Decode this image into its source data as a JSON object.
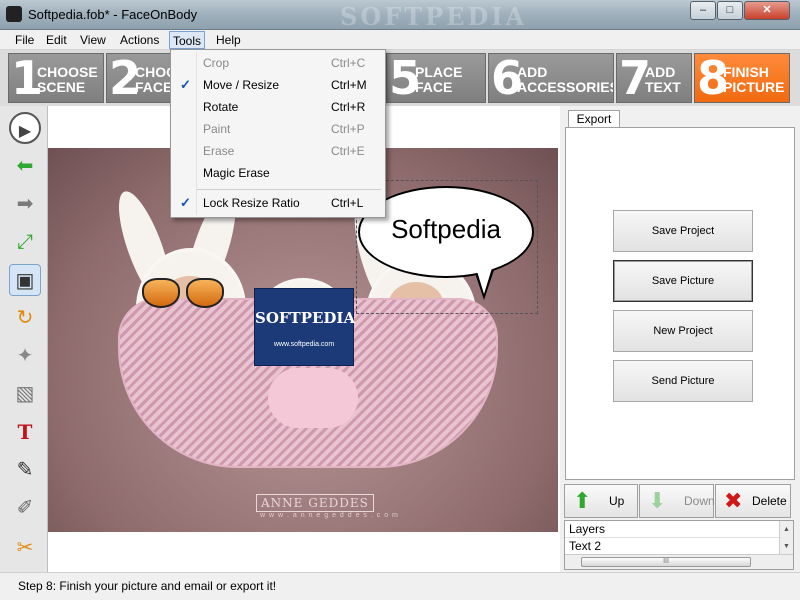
{
  "window": {
    "title": "Softpedia.fob* - FaceOnBody",
    "watermark": "SOFTPEDIA",
    "minimize": "–",
    "maximize": "□",
    "close": "✕"
  },
  "menubar": {
    "items": [
      "File",
      "Edit",
      "View",
      "Actions",
      "Tools",
      "Help"
    ]
  },
  "steps": [
    {
      "num": "1",
      "label": "CHOOSE\nSCENE"
    },
    {
      "num": "2",
      "label": "CHOO\nFACE"
    },
    {
      "num": "5",
      "label": "PLACE\nFACE"
    },
    {
      "num": "6",
      "label": "ADD\nACCESSORIES"
    },
    {
      "num": "7",
      "label": "ADD\nTEXT"
    },
    {
      "num": "8",
      "label": "FINISH\nPICTURE"
    }
  ],
  "tools_menu": [
    {
      "label": "Crop",
      "shortcut": "Ctrl+C",
      "checked": false,
      "enabled": false
    },
    {
      "label": "Move / Resize",
      "shortcut": "Ctrl+M",
      "checked": true,
      "enabled": true
    },
    {
      "label": "Rotate",
      "shortcut": "Ctrl+R",
      "checked": false,
      "enabled": true
    },
    {
      "label": "Paint",
      "shortcut": "Ctrl+P",
      "checked": false,
      "enabled": false
    },
    {
      "label": "Erase",
      "shortcut": "Ctrl+E",
      "checked": false,
      "enabled": false
    },
    {
      "label": "Magic Erase",
      "shortcut": "",
      "checked": false,
      "enabled": true
    },
    {
      "label": "Lock Resize Ratio",
      "shortcut": "Ctrl+L",
      "checked": true,
      "enabled": true
    }
  ],
  "check_mark": "✓",
  "left_tools": [
    {
      "name": "play-icon",
      "glyph": "▶",
      "color": "#2c2c2c"
    },
    {
      "name": "back-arrow-icon",
      "glyph": "⬅",
      "color": "#2fa82f"
    },
    {
      "name": "forward-arrow-icon",
      "glyph": "➡",
      "color": "#7a7a7a"
    },
    {
      "name": "fit-icon",
      "glyph": "⤢",
      "color": "#2fa82f"
    },
    {
      "name": "crop-icon",
      "glyph": "▣",
      "color": "#333"
    },
    {
      "name": "rotate-icon",
      "glyph": "↻",
      "color": "#e08a10"
    },
    {
      "name": "magic-icon",
      "glyph": "✦",
      "color": "#888"
    },
    {
      "name": "gradient-icon",
      "glyph": "▧",
      "color": "#777"
    },
    {
      "name": "text-tool-icon",
      "glyph": "T",
      "color": "#c0141b"
    },
    {
      "name": "brush-icon",
      "glyph": "✎",
      "color": "#333"
    },
    {
      "name": "pen-icon",
      "glyph": "✐",
      "color": "#666"
    },
    {
      "name": "eraser-icon",
      "glyph": "✂",
      "color": "#e08a10"
    }
  ],
  "canvas": {
    "bubble_text": "Softpedia",
    "logo_text": "SOFTPEDIA",
    "logo_url": "www.softpedia.com",
    "credit": "ANNE GEDDES",
    "credit_url": "w w w . a n n e g e d d e s . c o m"
  },
  "export_panel": {
    "tab": "Export",
    "buttons": [
      "Save Project",
      "Save Picture",
      "New Project",
      "Send Picture"
    ]
  },
  "layer_buttons": [
    {
      "label": "Up",
      "icon": "⬆",
      "color": "#2fa82f"
    },
    {
      "label": "Down",
      "icon": "⬇",
      "color": "#9bd19b"
    },
    {
      "label": "Delete",
      "icon": "✖",
      "color": "#d01818"
    }
  ],
  "layers": [
    "Layers",
    "Text 2"
  ],
  "scroll": {
    "up": "▲",
    "down": "▼",
    "thumb": "III"
  },
  "status": "Step 8: Finish your picture and email or export it!"
}
